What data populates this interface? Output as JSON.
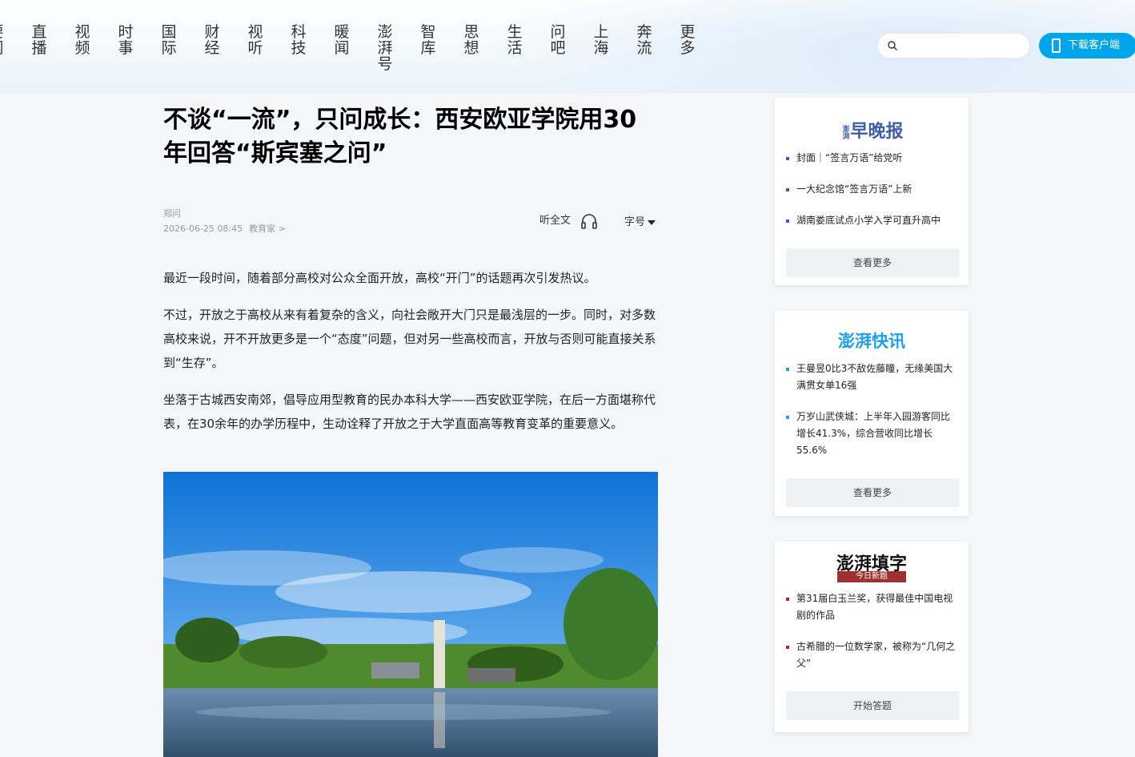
{
  "nav": {
    "items": [
      "要闻",
      "直播",
      "视频",
      "时事",
      "国际",
      "财经",
      "视听",
      "科技",
      "暖闻",
      "澎湃号",
      "智库",
      "思想",
      "生活",
      "问吧",
      "上海",
      "奔流",
      "更多"
    ]
  },
  "search": {
    "placeholder": ""
  },
  "download": {
    "label": "下载客户端"
  },
  "article": {
    "title": "不谈“一流”，只问成长：西安欧亚学院用30年回答“斯宾塞之问”",
    "author": "郑问",
    "datetime": "2026-06-25 08:45",
    "category": "教育家 >",
    "listen_label": "听全文",
    "font_label": "字号",
    "paragraphs": [
      "最近一段时间，随着部分高校对公众全面开放，高校“开门”的话题再次引发热议。",
      "不过，开放之于高校从来有着复杂的含义，向社会敞开大门只是最浅层的一步。同时，对多数高校来说，开不开放更多是一个“态度”问题，但对另一些高校而言，开放与否则可能直接关系到“生存”。",
      "坐落于古城西安南郊，倡导应用型教育的民办本科大学——西安欧亚学院，在后一方面堪称代表，在30余年的办学历程中，生动诠释了开放之于大学直面高等教育变革的重要意义。"
    ]
  },
  "sidebar": {
    "evening": {
      "logo_small": "澎湃",
      "logo": "早晚报",
      "items": [
        "封面｜“签言万语”给党听",
        "一大纪念馆“签言万语”上新",
        "湖南娄底试点小学入学可直升高中"
      ],
      "more": "查看更多",
      "color": "#3e5fa8"
    },
    "news": {
      "logo": "澎湃快讯",
      "items": [
        "王曼昱0比3不敌佐藤瞳，无缘美国大满贯女单16强",
        "万岁山武侠城：上半年入园游客同比增长41.3%，综合营收同比增长55.6%"
      ],
      "more": "查看更多",
      "color": "#1aa1e6"
    },
    "puzzle": {
      "logo": "澎湃填字",
      "logo_sub": "今日新题",
      "items": [
        "第31届白玉兰奖，获得最佳中国电视剧的作品",
        "古希腊的一位数学家，被称为“几何之父”"
      ],
      "more": "开始答题",
      "color": "#a03030"
    }
  }
}
